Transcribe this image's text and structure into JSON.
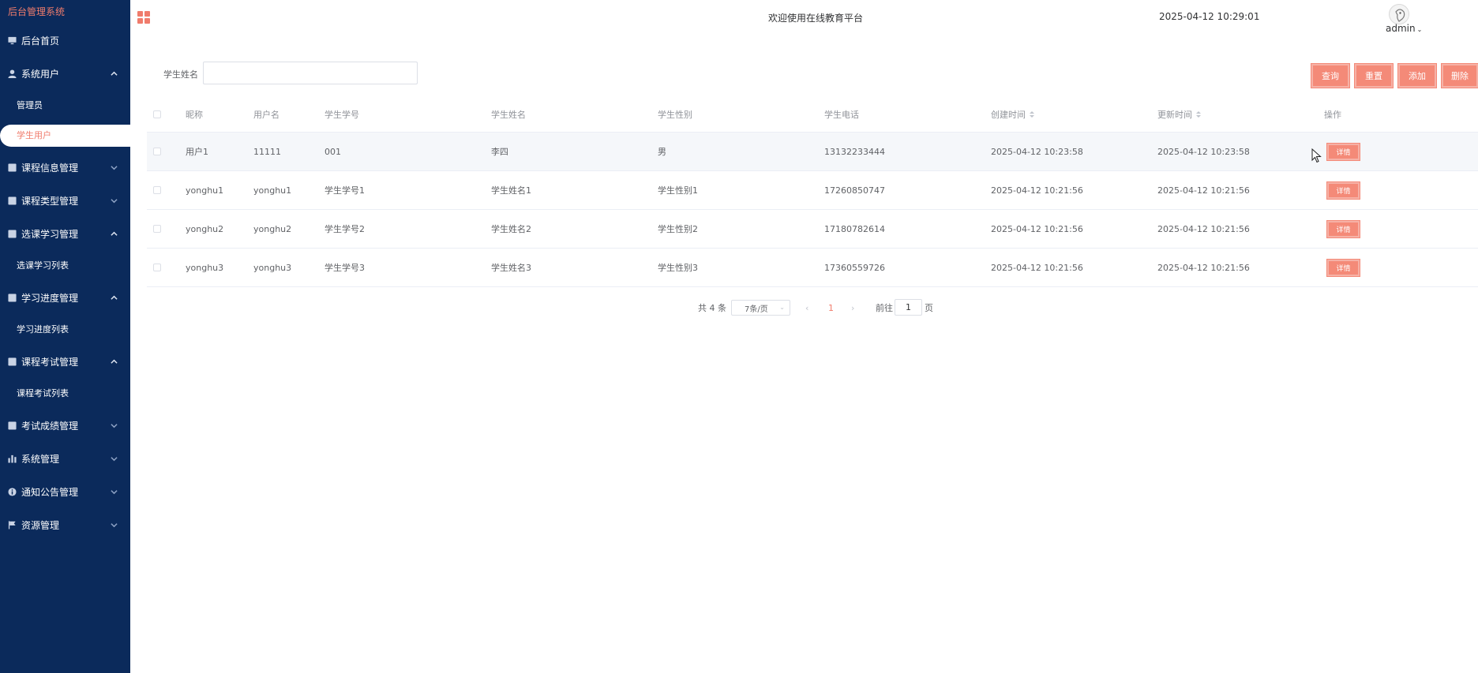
{
  "sidebar": {
    "brand": "后台管理系统",
    "home": "后台首页",
    "groups": [
      {
        "label": "系统用户",
        "icon": "user-icon",
        "expanded": true,
        "children": [
          "管理员",
          "学生用户"
        ]
      },
      {
        "label": "课程信息管理",
        "icon": "list-icon",
        "expanded": false,
        "children": []
      },
      {
        "label": "课程类型管理",
        "icon": "list-icon",
        "expanded": false,
        "children": []
      },
      {
        "label": "选课学习管理",
        "icon": "list-icon",
        "expanded": true,
        "children": [
          "选课学习列表"
        ]
      },
      {
        "label": "学习进度管理",
        "icon": "list-icon",
        "expanded": true,
        "children": [
          "学习进度列表"
        ]
      },
      {
        "label": "课程考试管理",
        "icon": "list-icon",
        "expanded": true,
        "children": [
          "课程考试列表"
        ]
      },
      {
        "label": "考试成绩管理",
        "icon": "list-icon",
        "expanded": false,
        "children": []
      },
      {
        "label": "系统管理",
        "icon": "bar-chart-icon",
        "expanded": false,
        "children": []
      },
      {
        "label": "通知公告管理",
        "icon": "info-icon",
        "expanded": false,
        "children": []
      },
      {
        "label": "资源管理",
        "icon": "flag-icon",
        "expanded": false,
        "children": []
      }
    ],
    "active_item": "学生用户"
  },
  "header": {
    "welcome": "欢迎使用在线教育平台",
    "datetime": "2025-04-12 10:29:01",
    "username": "admin"
  },
  "search": {
    "label": "学生姓名",
    "value": "",
    "placeholder": ""
  },
  "toolbar": {
    "query": "查询",
    "reset": "重置",
    "add": "添加",
    "delete": "删除"
  },
  "table": {
    "columns": [
      "昵称",
      "用户名",
      "学生学号",
      "学生姓名",
      "学生性别",
      "学生电话",
      "创建时间",
      "更新时间",
      "操作"
    ],
    "rows": [
      [
        "用户1",
        "11111",
        "001",
        "李四",
        "男",
        "13132233444",
        "2025-04-12 10:23:58",
        "2025-04-12 10:23:58"
      ],
      [
        "yonghu1",
        "yonghu1",
        "学生学号1",
        "学生姓名1",
        "学生性别1",
        "17260850747",
        "2025-04-12 10:21:56",
        "2025-04-12 10:21:56"
      ],
      [
        "yonghu2",
        "yonghu2",
        "学生学号2",
        "学生姓名2",
        "学生性别2",
        "17180782614",
        "2025-04-12 10:21:56",
        "2025-04-12 10:21:56"
      ],
      [
        "yonghu3",
        "yonghu3",
        "学生学号3",
        "学生姓名3",
        "学生性别3",
        "17360559726",
        "2025-04-12 10:21:56",
        "2025-04-12 10:21:56"
      ]
    ],
    "detail_label": "详情"
  },
  "pagination": {
    "total": "共 4 条",
    "page_size": "7条/页",
    "current": "1",
    "goto_prefix": "前往",
    "goto_value": "1",
    "goto_suffix": "页"
  },
  "colors": {
    "sidebar_bg": "#0b2a5b",
    "accent": "#f48a78",
    "brand_text": "#f07c6c"
  }
}
